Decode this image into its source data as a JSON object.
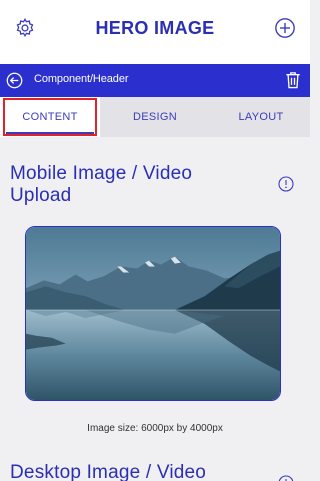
{
  "header": {
    "title": "HERO IMAGE",
    "settings_icon": "gear-icon",
    "add_icon": "plus-circle-icon"
  },
  "breadcrumb": {
    "path": "Component/Header",
    "back_icon": "back-arrow-circle-icon",
    "delete_icon": "trash-icon"
  },
  "tabs": [
    {
      "label": "CONTENT",
      "active": true
    },
    {
      "label": "DESIGN",
      "active": false
    },
    {
      "label": "LAYOUT",
      "active": false
    }
  ],
  "sections": {
    "mobile_title": "Mobile Image / Video Upload",
    "mobile_caption": "Image size: 6000px by 4000px",
    "desktop_title": "Desktop Image / Video"
  },
  "colors": {
    "accent": "#2b2fce",
    "title_text": "#2b2fb4",
    "highlight": "#e0232b"
  }
}
